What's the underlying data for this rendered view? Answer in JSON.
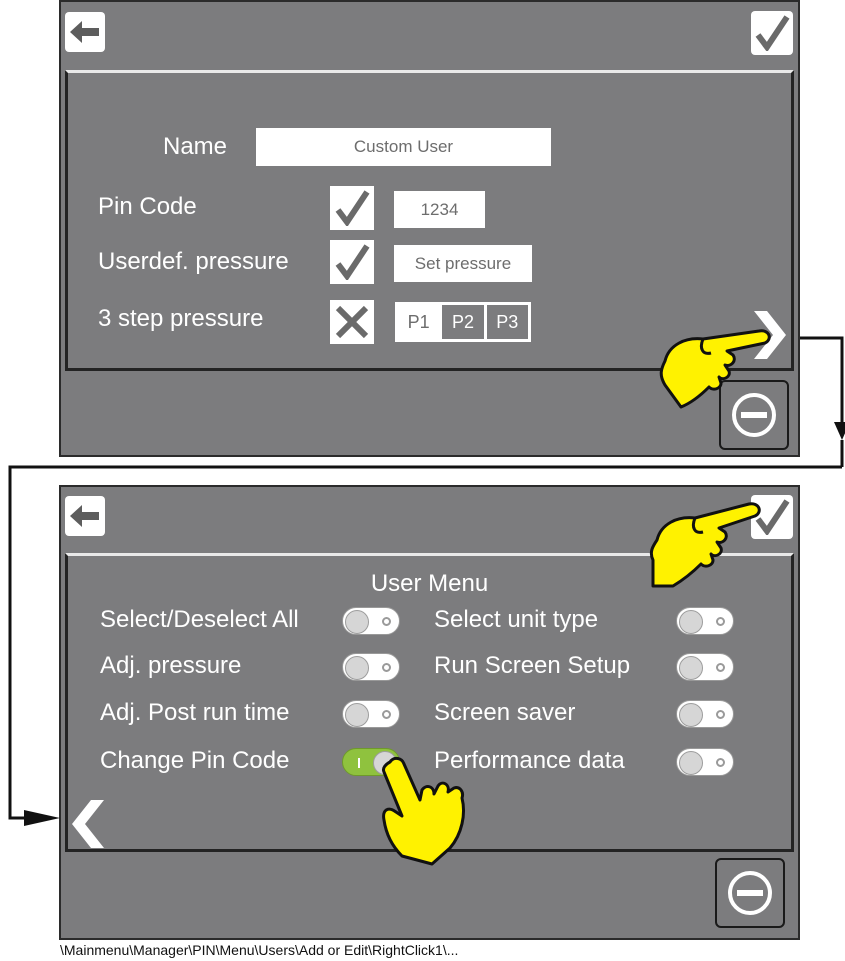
{
  "screen1": {
    "form": {
      "name_label": "Name",
      "name_value": "Custom User",
      "pin_label": "Pin Code",
      "pin_value": "1234",
      "pressure_label": "Userdef. pressure",
      "pressure_button": "Set pressure",
      "step_label": "3 step pressure",
      "p1": "P1",
      "p2": "P2",
      "p3": "P3"
    },
    "icons": {
      "back": "arrow-left-icon",
      "confirm": "checkmark-icon",
      "next": "chevron-right-icon",
      "minus": "minus-circle-icon"
    }
  },
  "screen2": {
    "menu_title": "User Menu",
    "left_items": [
      {
        "label": "Select/Deselect All",
        "state": "off"
      },
      {
        "label": "Adj. pressure",
        "state": "off"
      },
      {
        "label": "Adj.  Post run time",
        "state": "off"
      },
      {
        "label": "Change Pin Code",
        "state": "on"
      }
    ],
    "right_items": [
      {
        "label": "Select unit type",
        "state": "off"
      },
      {
        "label": "Run Screen Setup",
        "state": "off"
      },
      {
        "label": "Screen saver",
        "state": "off"
      },
      {
        "label": "Performance data",
        "state": "off"
      }
    ],
    "icons": {
      "back": "arrow-left-icon",
      "confirm": "checkmark-icon",
      "prev": "chevron-left-icon",
      "minus": "minus-circle-icon"
    }
  },
  "colors": {
    "screen_bg": "#7c7c7e",
    "toggle_on": "#8fc23e",
    "hand_fill": "#fff200"
  },
  "caption": "\\Mainmenu\\Manager\\PIN\\Menu\\Users\\Add or Edit\\RightClick1\\..."
}
